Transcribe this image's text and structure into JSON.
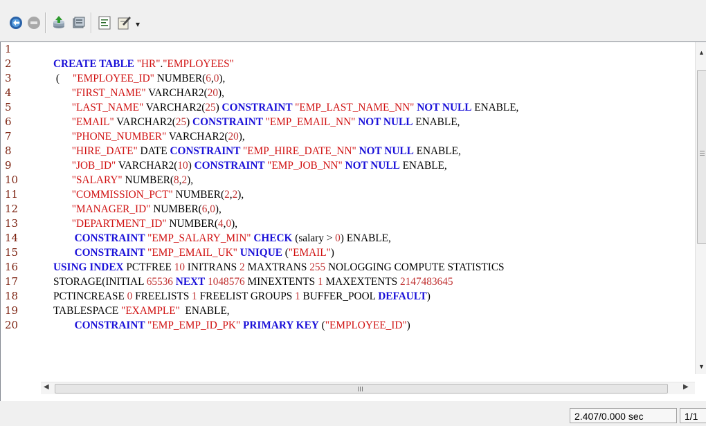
{
  "toolbar": {
    "buttons": [
      {
        "icon": "execute-icon",
        "title": "Execute"
      },
      {
        "icon": "stop-icon",
        "title": "Stop"
      },
      {
        "icon": "commit-icon",
        "title": "Commit"
      },
      {
        "icon": "rollback-icon",
        "title": "Rollback"
      },
      {
        "icon": "format-icon",
        "title": "Format"
      },
      {
        "icon": "clear-icon",
        "title": "Clear"
      }
    ],
    "dropdown_icon": "chevron-down-icon"
  },
  "editor": {
    "line_numbers": [
      "1",
      "2",
      "3",
      "4",
      "5",
      "6",
      "7",
      "8",
      "9",
      "10",
      "11",
      "12",
      "13",
      "14",
      "15",
      "16",
      "17",
      "18",
      "19",
      "20"
    ],
    "lines": [
      [],
      [
        [
          "kw",
          "CREATE TABLE "
        ],
        [
          "str",
          "\"HR\""
        ],
        [
          "txt",
          "."
        ],
        [
          "str",
          "\"EMPLOYEES\""
        ]
      ],
      [
        [
          "txt",
          " (     "
        ],
        [
          "str",
          "\"EMPLOYEE_ID\""
        ],
        [
          "txt",
          " NUMBER("
        ],
        [
          "num",
          "6"
        ],
        [
          "txt",
          ","
        ],
        [
          "num",
          "0"
        ],
        [
          "txt",
          "),"
        ]
      ],
      [
        [
          "txt",
          "       "
        ],
        [
          "str",
          "\"FIRST_NAME\""
        ],
        [
          "txt",
          " VARCHAR2("
        ],
        [
          "num",
          "20"
        ],
        [
          "txt",
          "),"
        ]
      ],
      [
        [
          "txt",
          "       "
        ],
        [
          "str",
          "\"LAST_NAME\""
        ],
        [
          "txt",
          " VARCHAR2("
        ],
        [
          "num",
          "25"
        ],
        [
          "txt",
          ") "
        ],
        [
          "kw",
          "CONSTRAINT "
        ],
        [
          "str",
          "\"EMP_LAST_NAME_NN\""
        ],
        [
          "txt",
          " "
        ],
        [
          "kw",
          "NOT NULL"
        ],
        [
          "txt",
          " ENABLE,"
        ]
      ],
      [
        [
          "txt",
          "       "
        ],
        [
          "str",
          "\"EMAIL\""
        ],
        [
          "txt",
          " VARCHAR2("
        ],
        [
          "num",
          "25"
        ],
        [
          "txt",
          ") "
        ],
        [
          "kw",
          "CONSTRAINT "
        ],
        [
          "str",
          "\"EMP_EMAIL_NN\""
        ],
        [
          "txt",
          " "
        ],
        [
          "kw",
          "NOT NULL"
        ],
        [
          "txt",
          " ENABLE,"
        ]
      ],
      [
        [
          "txt",
          "       "
        ],
        [
          "str",
          "\"PHONE_NUMBER\""
        ],
        [
          "txt",
          " VARCHAR2("
        ],
        [
          "num",
          "20"
        ],
        [
          "txt",
          "),"
        ]
      ],
      [
        [
          "txt",
          "       "
        ],
        [
          "str",
          "\"HIRE_DATE\""
        ],
        [
          "txt",
          " DATE "
        ],
        [
          "kw",
          "CONSTRAINT "
        ],
        [
          "str",
          "\"EMP_HIRE_DATE_NN\""
        ],
        [
          "txt",
          " "
        ],
        [
          "kw",
          "NOT NULL"
        ],
        [
          "txt",
          " ENABLE,"
        ]
      ],
      [
        [
          "txt",
          "       "
        ],
        [
          "str",
          "\"JOB_ID\""
        ],
        [
          "txt",
          " VARCHAR2("
        ],
        [
          "num",
          "10"
        ],
        [
          "txt",
          ") "
        ],
        [
          "kw",
          "CONSTRAINT "
        ],
        [
          "str",
          "\"EMP_JOB_NN\""
        ],
        [
          "txt",
          " "
        ],
        [
          "kw",
          "NOT NULL"
        ],
        [
          "txt",
          " ENABLE,"
        ]
      ],
      [
        [
          "txt",
          "       "
        ],
        [
          "str",
          "\"SALARY\""
        ],
        [
          "txt",
          " NUMBER("
        ],
        [
          "num",
          "8"
        ],
        [
          "txt",
          ","
        ],
        [
          "num",
          "2"
        ],
        [
          "txt",
          "),"
        ]
      ],
      [
        [
          "txt",
          "       "
        ],
        [
          "str",
          "\"COMMISSION_PCT\""
        ],
        [
          "txt",
          " NUMBER("
        ],
        [
          "num",
          "2"
        ],
        [
          "txt",
          ","
        ],
        [
          "num",
          "2"
        ],
        [
          "txt",
          "),"
        ]
      ],
      [
        [
          "txt",
          "       "
        ],
        [
          "str",
          "\"MANAGER_ID\""
        ],
        [
          "txt",
          " NUMBER("
        ],
        [
          "num",
          "6"
        ],
        [
          "txt",
          ","
        ],
        [
          "num",
          "0"
        ],
        [
          "txt",
          "),"
        ]
      ],
      [
        [
          "txt",
          "       "
        ],
        [
          "str",
          "\"DEPARTMENT_ID\""
        ],
        [
          "txt",
          " NUMBER("
        ],
        [
          "num",
          "4"
        ],
        [
          "txt",
          ","
        ],
        [
          "num",
          "0"
        ],
        [
          "txt",
          "),"
        ]
      ],
      [
        [
          "txt",
          "        "
        ],
        [
          "kw",
          "CONSTRAINT "
        ],
        [
          "str",
          "\"EMP_SALARY_MIN\""
        ],
        [
          "txt",
          " "
        ],
        [
          "kw",
          "CHECK"
        ],
        [
          "txt",
          " (salary > "
        ],
        [
          "num",
          "0"
        ],
        [
          "txt",
          ") ENABLE,"
        ]
      ],
      [
        [
          "txt",
          "        "
        ],
        [
          "kw",
          "CONSTRAINT "
        ],
        [
          "str",
          "\"EMP_EMAIL_UK\""
        ],
        [
          "txt",
          " "
        ],
        [
          "kw",
          "UNIQUE"
        ],
        [
          "txt",
          " ("
        ],
        [
          "str",
          "\"EMAIL\""
        ],
        [
          "txt",
          ")"
        ]
      ],
      [
        [
          "kw",
          "USING INDEX"
        ],
        [
          "txt",
          " PCTFREE "
        ],
        [
          "num",
          "10"
        ],
        [
          "txt",
          " INITRANS "
        ],
        [
          "num",
          "2"
        ],
        [
          "txt",
          " MAXTRANS "
        ],
        [
          "num",
          "255"
        ],
        [
          "txt",
          " NOLOGGING COMPUTE STATISTICS"
        ]
      ],
      [
        [
          "txt",
          "STORAGE(INITIAL "
        ],
        [
          "num",
          "65536"
        ],
        [
          "txt",
          " "
        ],
        [
          "kw",
          "NEXT"
        ],
        [
          "txt",
          " "
        ],
        [
          "num",
          "1048576"
        ],
        [
          "txt",
          " MINEXTENTS "
        ],
        [
          "num",
          "1"
        ],
        [
          "txt",
          " MAXEXTENTS "
        ],
        [
          "num",
          "2147483645"
        ]
      ],
      [
        [
          "txt",
          "PCTINCREASE "
        ],
        [
          "num",
          "0"
        ],
        [
          "txt",
          " FREELISTS "
        ],
        [
          "num",
          "1"
        ],
        [
          "txt",
          " FREELIST GROUPS "
        ],
        [
          "num",
          "1"
        ],
        [
          "txt",
          " BUFFER_POOL "
        ],
        [
          "kw",
          "DEFAULT"
        ],
        [
          "txt",
          ")"
        ]
      ],
      [
        [
          "txt",
          "TABLESPACE "
        ],
        [
          "str",
          "\"EXAMPLE\""
        ],
        [
          "txt",
          "  ENABLE,"
        ]
      ],
      [
        [
          "txt",
          "        "
        ],
        [
          "kw",
          "CONSTRAINT "
        ],
        [
          "str",
          "\"EMP_EMP_ID_PK\""
        ],
        [
          "txt",
          " "
        ],
        [
          "kw",
          "PRIMARY KEY"
        ],
        [
          "txt",
          " ("
        ],
        [
          "str",
          "\"EMPLOYEE_ID\""
        ],
        [
          "txt",
          ")"
        ]
      ]
    ]
  },
  "scrollbar": {
    "up_arrow": "▲",
    "down_arrow": "▼",
    "left_arrow": "◀",
    "right_arrow": "▶"
  },
  "status": {
    "timing": "2.407/0.000 sec",
    "position": "1/1"
  },
  "colors": {
    "keyword": "#1a10d8",
    "string": "#d01010",
    "number": "#c03030",
    "line_number": "#7a1e0c"
  }
}
